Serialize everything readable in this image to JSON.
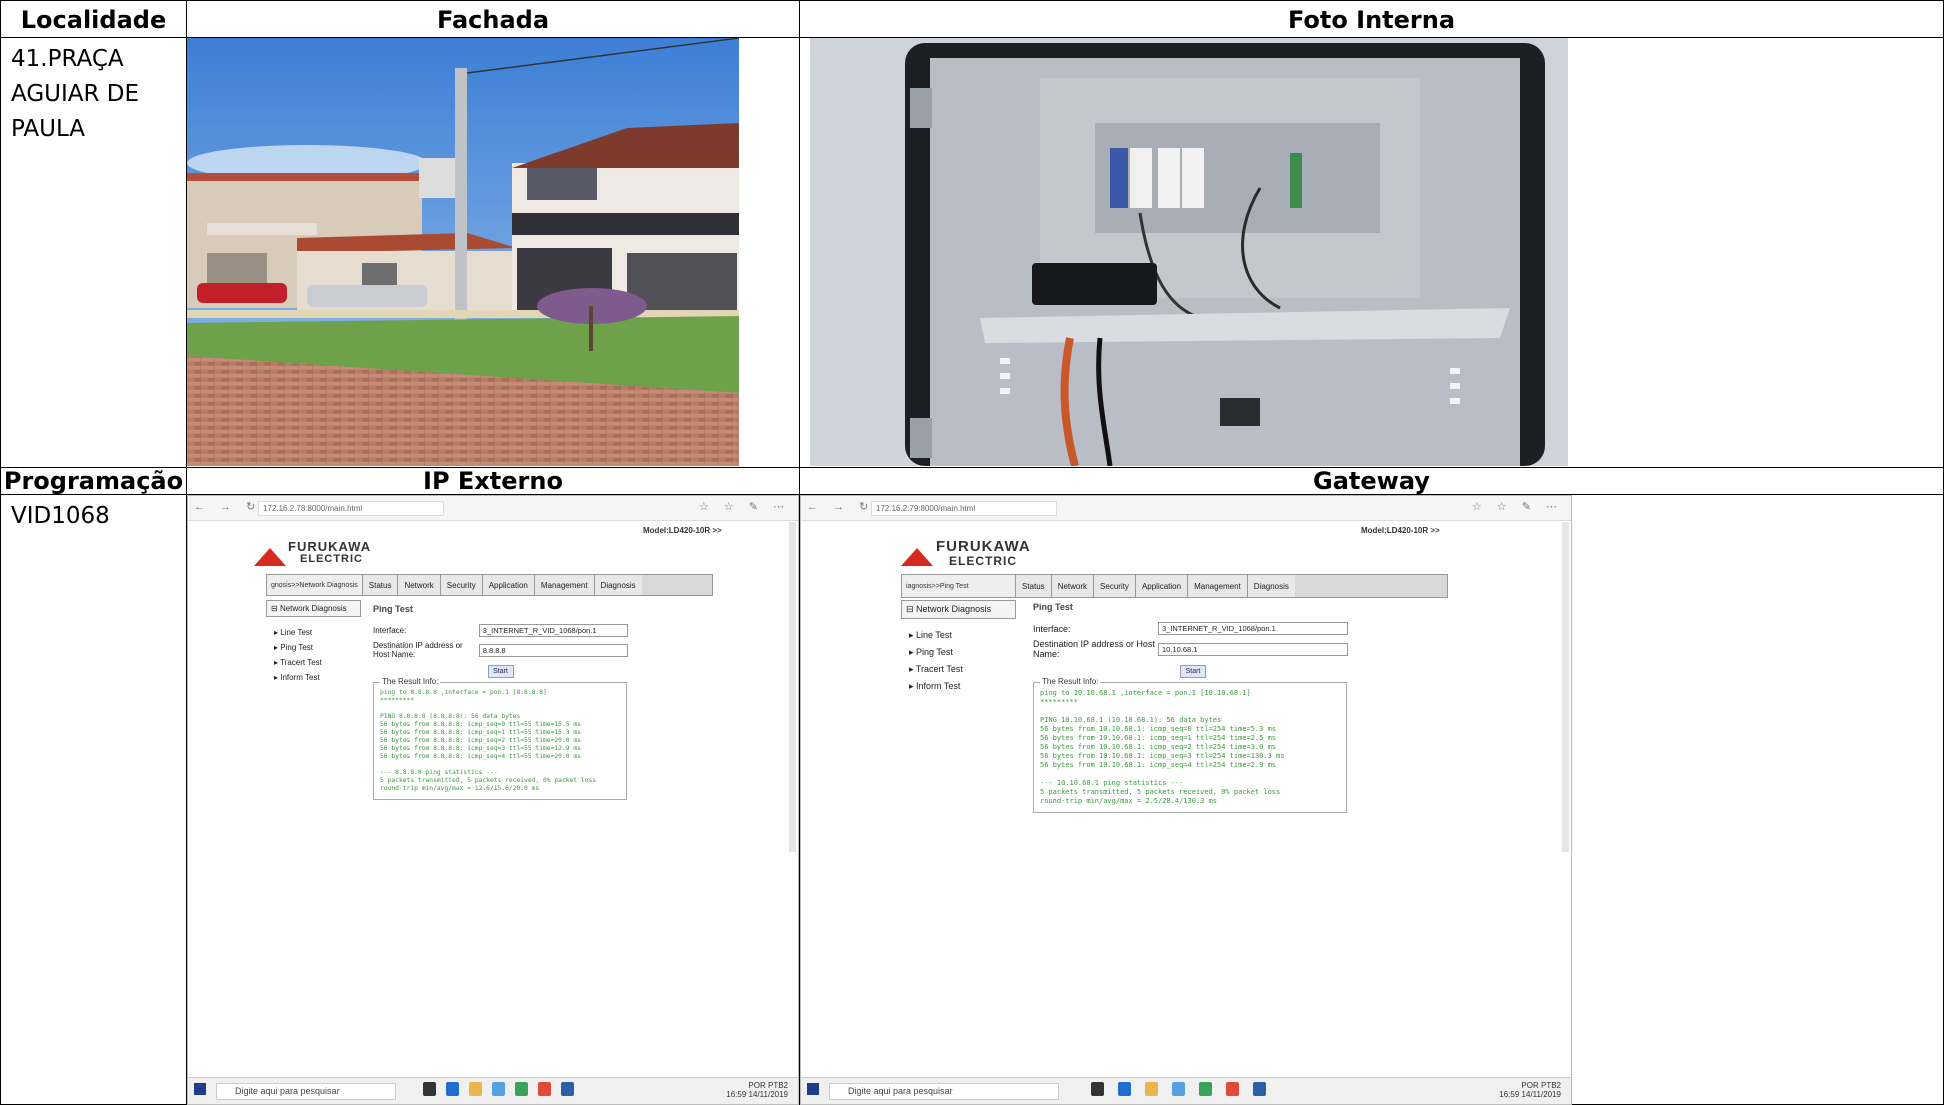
{
  "headers": {
    "localidade": "Localidade",
    "fachada": "Fachada",
    "foto_interna": "Foto Interna",
    "programacao": "Programação",
    "ip_externo": "IP Externo",
    "gateway": "Gateway"
  },
  "localidade_lines": [
    "41.PRAÇA",
    "AGUIAR DE",
    "PAULA"
  ],
  "programacao_value": "VID1068",
  "ip_externo": {
    "url": "172.16.2.78:8000/main.html",
    "model": "Model:LD420-10R >>",
    "logo_line1": "FURUKAWA",
    "logo_line2": "ELECTRIC",
    "breadcrumb": "gnosis>>Network Diagnosis",
    "tabs": [
      "Status",
      "Network",
      "Security",
      "Application",
      "Management",
      "Diagnosis"
    ],
    "side_head": "Network Diagnosis",
    "side_items": [
      "Line Test",
      "Ping Test",
      "Tracert Test",
      "Inform Test"
    ],
    "title": "Ping Test",
    "interface_label": "Interface:",
    "interface_value": "3_INTERNET_R_VID_1068/pon.1",
    "dest_label": "Destination IP address or Host Name:",
    "dest_value": "8.8.8.8",
    "start": "Start",
    "result_legend": "The Result Info:",
    "result_text": "ping to 8.8.8.8 ,interface = pon.1 [8.8.8.8]\n*********\n\nPING 8.8.8.8 (8.8.8.8): 56 data bytes\n56 bytes from 8.8.8.8: icmp_seq=0 ttl=55 time=15.5 ms\n56 bytes from 8.8.8.8: icmp_seq=1 ttl=55 time=15.3 ms\n56 bytes from 8.8.8.8: icmp_seq=2 ttl=55 time=20.0 ms\n56 bytes from 8.8.8.8: icmp_seq=3 ttl=55 time=12.9 ms\n56 bytes from 8.8.8.8: icmp_seq=4 ttl=55 time=20.0 ms\n\n--- 8.8.8.8 ping statistics ---\n5 packets transmitted, 5 packets received, 0% packet loss\nround-trip min/avg/max = 12.6/15.6/20.0 ms",
    "search_placeholder": "Digite aqui para pesquisar",
    "tray_lang": "POR PTB2",
    "tray_time": "16:59",
    "tray_date": "14/11/2019"
  },
  "gateway": {
    "url": "172.16.2.79:8000/main.html",
    "model": "Model:LD420-10R >>",
    "logo_line1": "FURUKAWA",
    "logo_line2": "ELECTRIC",
    "breadcrumb": "iagnosis>>Ping Test",
    "tabs": [
      "Status",
      "Network",
      "Security",
      "Application",
      "Management",
      "Diagnosis"
    ],
    "side_head": "Network Diagnosis",
    "side_items": [
      "Line Test",
      "Ping Test",
      "Tracert Test",
      "Inform Test"
    ],
    "title": "Ping Test",
    "interface_label": "Interface:",
    "interface_value": "3_INTERNET_R_VID_1068/pon.1",
    "dest_label": "Destination IP address or Host Name:",
    "dest_value": "10.10.68.1",
    "start": "Start",
    "result_legend": "The Result Info:",
    "result_text": "ping to 10.10.68.1 ,interface = pon.1 [10.10.68.1]\n*********\n\nPING 10.10.68.1 (10.10.68.1): 56 data bytes\n56 bytes from 10.10.68.1: icmp_seq=0 ttl=254 time=5.3 ms\n56 bytes from 10.10.68.1: icmp_seq=1 ttl=254 time=2.5 ms\n56 bytes from 10.10.68.1: icmp_seq=2 ttl=254 time=3.0 ms\n56 bytes from 10.10.68.1: icmp_seq=3 ttl=254 time=130.3 ms\n56 bytes from 10.10.68.1: icmp_seq=4 ttl=254 time=2.9 ms\n\n--- 10.10.68.1 ping statistics ---\n5 packets transmitted, 5 packets received, 0% packet loss\nround-trip min/avg/max = 2.5/28.4/130.3 ms",
    "search_placeholder": "Digite aqui para pesquisar",
    "tray_lang": "POR PTB2",
    "tray_time": "16:59",
    "tray_date": "14/11/2019"
  }
}
